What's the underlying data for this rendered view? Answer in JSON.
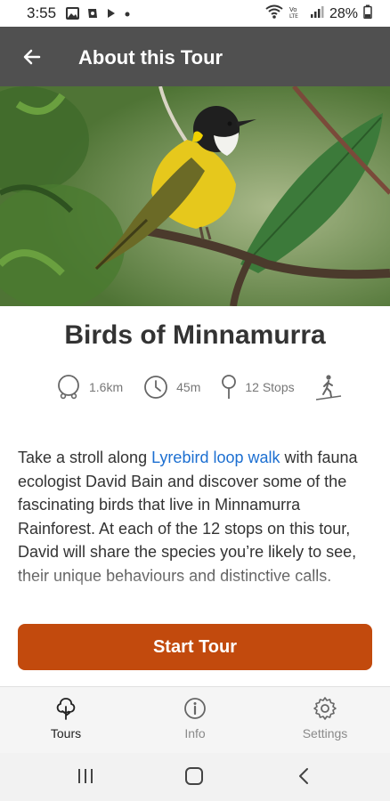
{
  "status_bar": {
    "time": "3:55",
    "battery": "28%",
    "icons": [
      "image-icon",
      "sim-icon",
      "play-icon",
      "dot-icon",
      "wifi-icon",
      "volte-icon",
      "signal-icon",
      "battery-icon"
    ]
  },
  "app_bar": {
    "title": "About this Tour",
    "back_icon": "arrow-left-icon"
  },
  "tour": {
    "title": "Birds of Minnamurra",
    "stats": {
      "distance": "1.6km",
      "duration": "45m",
      "stops": "12 Stops",
      "activity_icon": "hiker-icon"
    },
    "description": {
      "before_link": "Take a stroll along ",
      "link": "Lyrebird loop walk",
      "after_link": " with fauna ecologist David Bain and discover some of the fascinating birds that live in Minnamurra Rainforest. At each of the 12 stops on this tour, David will share the species you’re likely to see, their unique behaviours and distinctive calls."
    },
    "start_button": "Start Tour"
  },
  "bottom_nav": {
    "items": [
      {
        "label": "Tours",
        "icon": "tree-icon",
        "active": true
      },
      {
        "label": "Info",
        "icon": "info-icon",
        "active": false
      },
      {
        "label": "Settings",
        "icon": "gear-icon",
        "active": false
      }
    ]
  },
  "system_nav": {
    "icons": [
      "recents-icon",
      "home-icon",
      "back-icon"
    ]
  },
  "colors": {
    "app_bar": "#505050",
    "accent": "#c24a0d",
    "link": "#1c6fd1"
  }
}
